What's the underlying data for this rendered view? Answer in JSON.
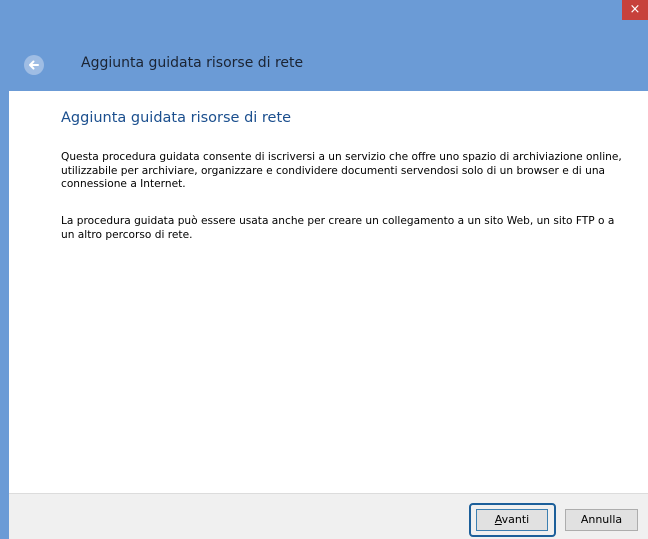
{
  "window": {
    "close_glyph": "×"
  },
  "header": {
    "title": "Aggiunta guidata risorse di rete",
    "back_icon": "back-arrow-icon"
  },
  "content": {
    "title": "Aggiunta guidata risorse di rete",
    "paragraph1": "Questa procedura guidata consente di iscriversi a un servizio che offre uno spazio di archiviazione online, utilizzabile per archiviare, organizzare e condividere documenti servendosi solo di un browser e di una connessione a Internet.",
    "paragraph2": "La procedura guidata può essere usata anche per creare un collegamento a un sito Web, un sito FTP o a un altro percorso di rete."
  },
  "footer": {
    "next_label_accel": "A",
    "next_label_rest": "vanti",
    "cancel_label": "Annulla"
  },
  "colors": {
    "chrome": "#6b9bd6",
    "close": "#c7413b",
    "title_text": "#1b4f8e"
  }
}
